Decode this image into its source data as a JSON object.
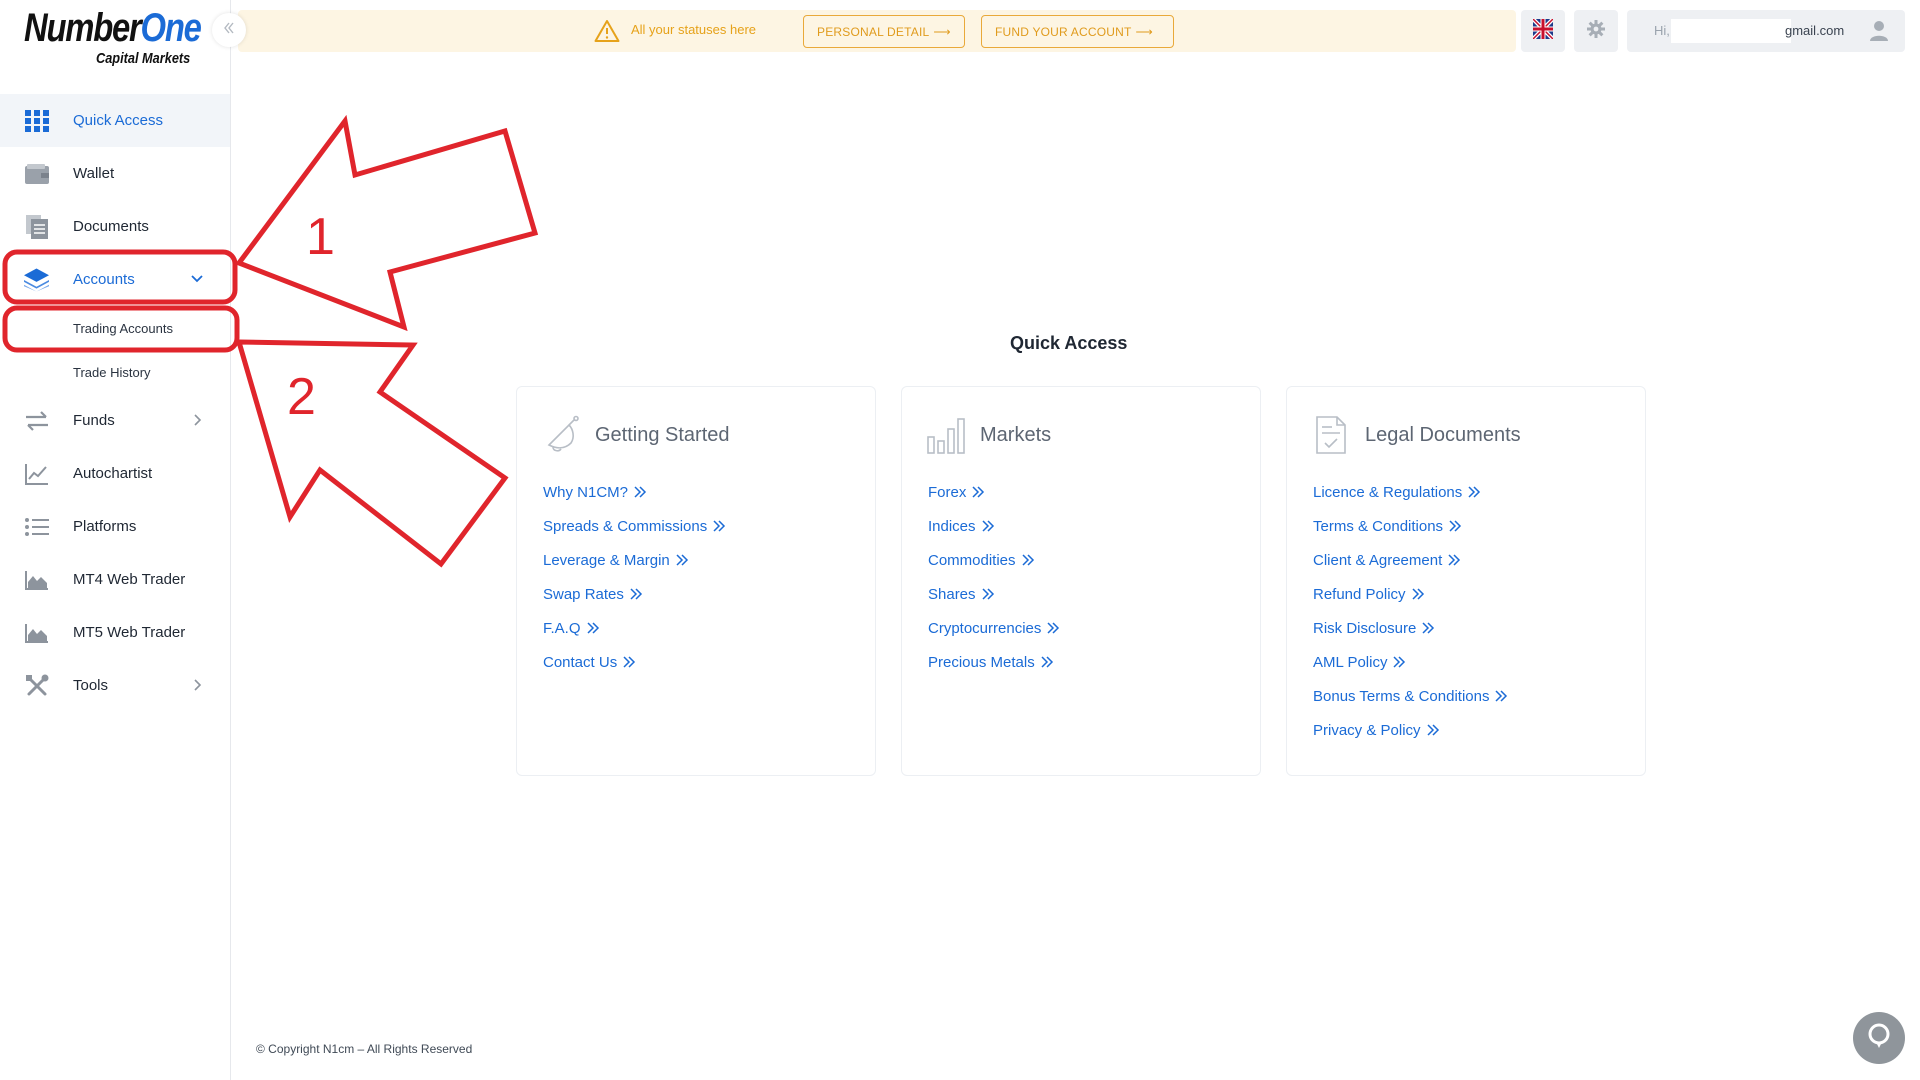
{
  "logo": {
    "word_main": "Number",
    "word_accent": "One",
    "sub": "Capital Markets"
  },
  "sidebar": {
    "items": [
      {
        "label": "Quick Access",
        "icon": "grid-icon"
      },
      {
        "label": "Wallet",
        "icon": "wallet-icon"
      },
      {
        "label": "Documents",
        "icon": "documents-icon"
      },
      {
        "label": "Accounts",
        "icon": "layers-icon",
        "expanded": true,
        "children": [
          {
            "label": "Trading Accounts"
          },
          {
            "label": "Trade History"
          }
        ]
      },
      {
        "label": "Funds",
        "icon": "transfer-icon"
      },
      {
        "label": "Autochartist",
        "icon": "chart-line-icon"
      },
      {
        "label": "Platforms",
        "icon": "list-icon"
      },
      {
        "label": "MT4 Web Trader",
        "icon": "area-chart-icon"
      },
      {
        "label": "MT5 Web Trader",
        "icon": "area-chart-icon"
      },
      {
        "label": "Tools",
        "icon": "tools-icon"
      }
    ]
  },
  "alert": {
    "text": "All your statuses here",
    "personal_button": "PERSONAL DETAIL",
    "fund_button": "FUND YOUR ACCOUNT",
    "color": "#e6a21a"
  },
  "user": {
    "greeting": "Hi,",
    "email_suffix": "gmail.com"
  },
  "main": {
    "title": "Quick Access",
    "cards": [
      {
        "title": "Getting Started",
        "icon": "bell-icon",
        "links": [
          "Why N1CM?",
          "Spreads & Commissions",
          "Leverage & Margin",
          "Swap Rates",
          "F.A.Q",
          "Contact Us"
        ]
      },
      {
        "title": "Markets",
        "icon": "bar-chart-icon",
        "links": [
          "Forex",
          "Indices",
          "Commodities",
          "Shares",
          "Cryptocurrencies",
          "Precious Metals"
        ]
      },
      {
        "title": "Legal Documents",
        "icon": "document-check-icon",
        "links": [
          "Licence & Regulations",
          "Terms & Conditions",
          "Client & Agreement",
          "Refund Policy",
          "Risk Disclosure",
          "AML Policy",
          "Bonus Terms & Conditions",
          "Privacy & Policy"
        ]
      }
    ]
  },
  "footer": {
    "text": "© Copyright N1cm – All Rights Reserved"
  },
  "annotations": {
    "label_1": "1",
    "label_2": "2",
    "color": "#e0252c"
  },
  "colors": {
    "accent": "#1b6bd6",
    "warning": "#e6a21a"
  }
}
